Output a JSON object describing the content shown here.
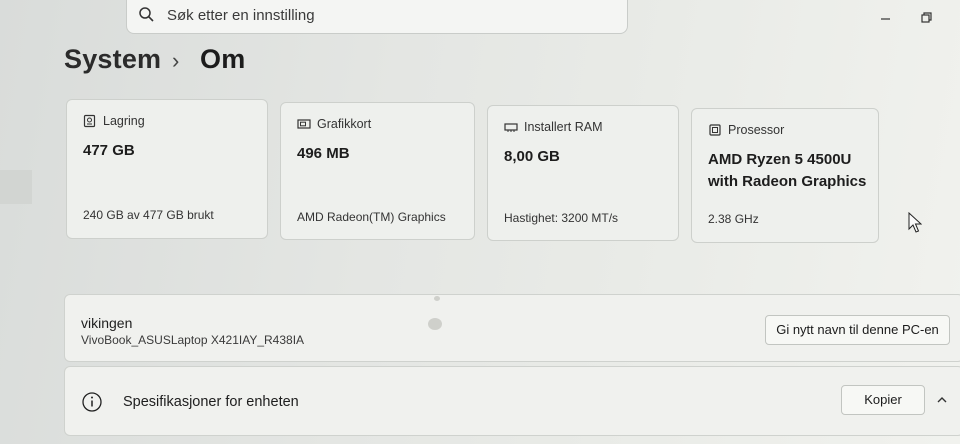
{
  "search": {
    "placeholder": "Søk etter en innstilling",
    "icon": "search-icon"
  },
  "breadcrumb": {
    "parent": "System",
    "separator": "›",
    "current": "Om"
  },
  "cards": [
    {
      "title": "Lagring",
      "value": "477 GB",
      "value2": "",
      "sub": "240 GB av 477 GB brukt",
      "icon": "storage-icon"
    },
    {
      "title": "Grafikkort",
      "value": "496 MB",
      "value2": "",
      "sub": "AMD Radeon(TM) Graphics",
      "icon": "graphics-card-icon"
    },
    {
      "title": "Installert RAM",
      "value": "8,00 GB",
      "value2": "",
      "sub": "Hastighet: 3200 MT/s",
      "icon": "ram-icon"
    },
    {
      "title": "Prosessor",
      "value": "AMD Ryzen 5 4500U",
      "value2": "with Radeon Graphics",
      "sub": "2.38 GHz",
      "icon": "processor-icon"
    }
  ],
  "device": {
    "name": "vikingen",
    "model": "VivoBook_ASUSLaptop X421IAY_R438IA",
    "rename_button": "Gi nytt navn til denne PC-en"
  },
  "specs": {
    "title": "Spesifikasjoner for enheten",
    "copy_button": "Kopier",
    "icon": "info-icon"
  },
  "colors": {
    "background": "#e6e8e4",
    "card": "#eef0ed",
    "text": "#1b1b1b"
  }
}
